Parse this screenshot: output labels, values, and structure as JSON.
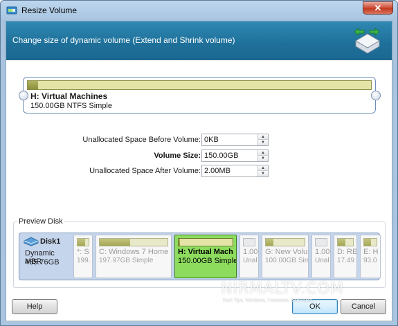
{
  "window": {
    "title": "Resize Volume",
    "close_label": "✕"
  },
  "banner": {
    "text": "Change size of dynamic volume (Extend and Shrink volume)",
    "icon": "resize-volume-icon"
  },
  "volume": {
    "name": "H: Virtual Machines",
    "desc": "150.00GB NTFS Simple",
    "used_fraction": 0.03
  },
  "fields": {
    "before_label": "Unallocated Space Before Volume:",
    "before_value": "0KB",
    "size_label": "Volume Size:",
    "size_value": "150.00GB",
    "after_label": "Unallocated Space After Volume:",
    "after_value": "2.00MB"
  },
  "preview": {
    "label": "Preview Disk",
    "disk": {
      "name": "Disk1",
      "type": "Dynamic MBR",
      "size": "465.76GB"
    },
    "partitions": [
      {
        "name": "*: S",
        "sub": "199.",
        "used_fraction": 0.7,
        "grey": false
      },
      {
        "name": "C: Windows 7 Home",
        "sub": "197.97GB Simple",
        "used_fraction": 0.45,
        "grey": false
      },
      {
        "name": "H: Virtual Mach",
        "sub": "150.00GB Simple",
        "used_fraction": 0.03,
        "grey": false,
        "selected": true
      },
      {
        "name": "1.00",
        "sub": "Unal",
        "used_fraction": 0,
        "grey": true
      },
      {
        "name": "G: New Volu",
        "sub": "100.00GB Sim",
        "used_fraction": 0.2,
        "grey": false
      },
      {
        "name": "1.00",
        "sub": "Unal",
        "used_fraction": 0,
        "grey": true
      },
      {
        "name": "D: RE",
        "sub": "17.49",
        "used_fraction": 0.5,
        "grey": false
      },
      {
        "name": "E: H",
        "sub": "93.0",
        "used_fraction": 0.55,
        "grey": false
      }
    ]
  },
  "buttons": {
    "help": "Help",
    "ok": "OK",
    "cancel": "Cancel"
  },
  "watermark": {
    "text": "NIRMALTV.COM",
    "sub": "Tech Tips, Windows, Freeware, Softwares..."
  }
}
